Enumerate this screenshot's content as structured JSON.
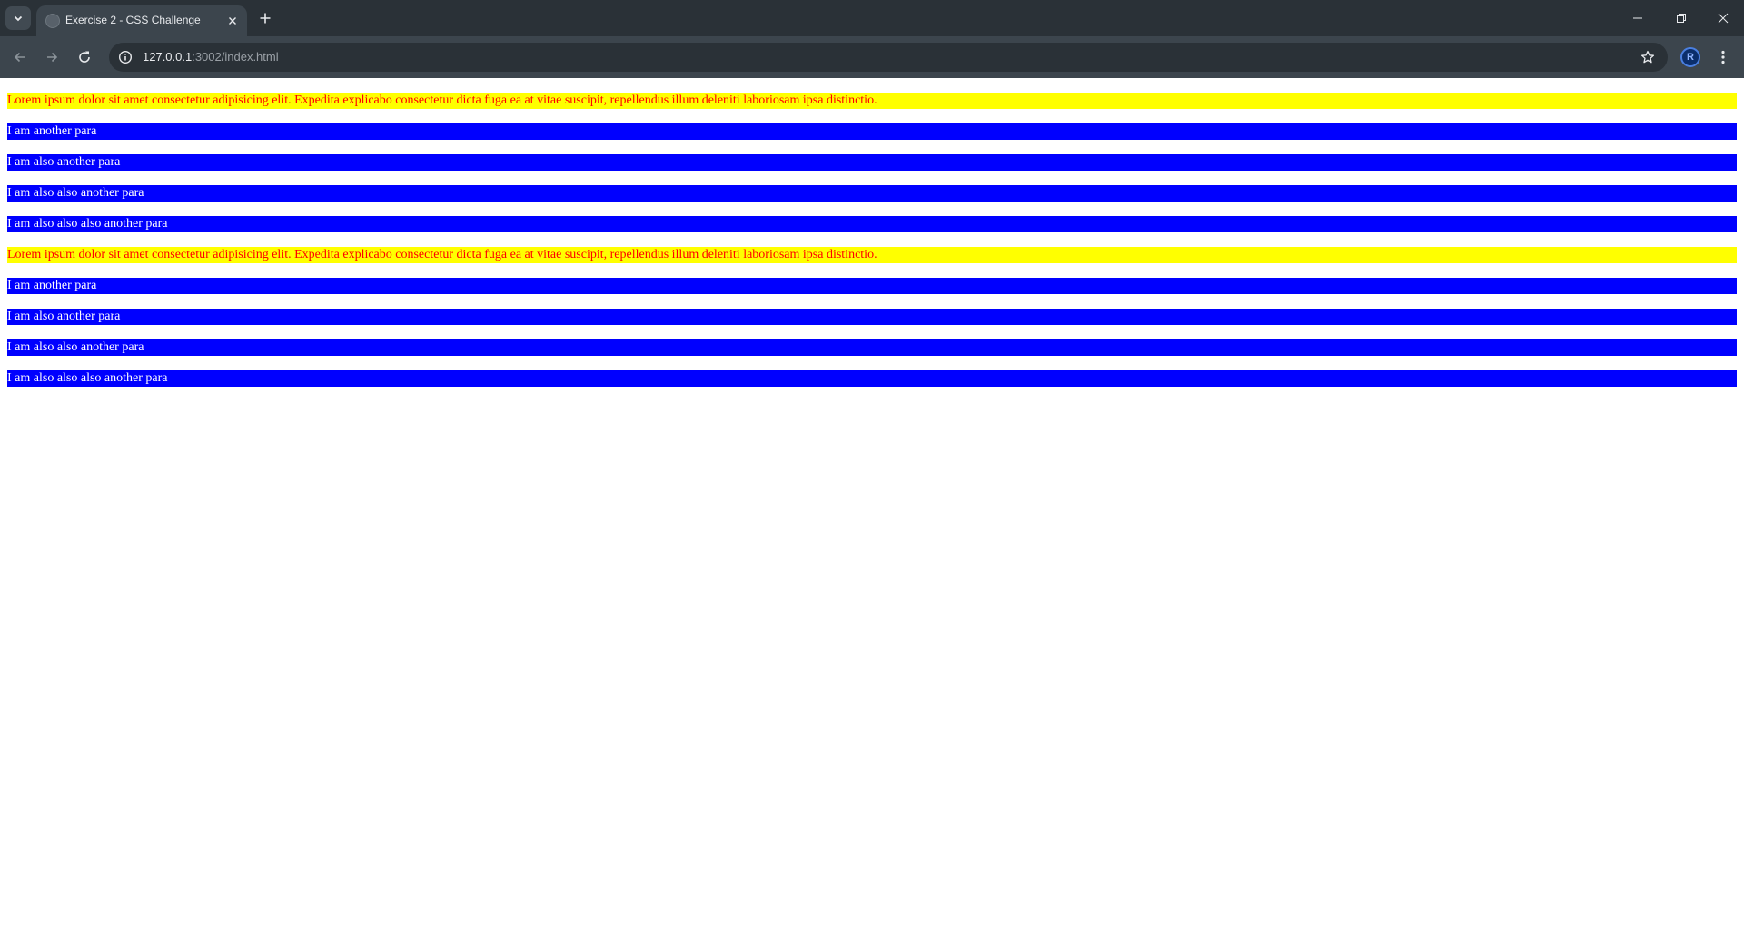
{
  "browser": {
    "tab_title": "Exercise 2 - CSS Challenge",
    "url_host": "127.0.0.1",
    "url_path": ":3002/index.html",
    "profile_initial": "R"
  },
  "content": {
    "groups": [
      {
        "lorem": "Lorem ipsum dolor sit amet consectetur adipisicing elit. Expedita explicabo consectetur dicta fuga ea at vitae suscipit, repellendus illum deleniti laboriosam ipsa distinctio.",
        "paras": [
          "I am another para",
          "I am also another para",
          "I am also also another para",
          "I am also also also another para"
        ]
      },
      {
        "lorem": "Lorem ipsum dolor sit amet consectetur adipisicing elit. Expedita explicabo consectetur dicta fuga ea at vitae suscipit, repellendus illum deleniti laboriosam ipsa distinctio.",
        "paras": [
          "I am another para",
          "I am also another para",
          "I am also also another para",
          "I am also also also another para"
        ]
      }
    ]
  },
  "colors": {
    "lorem_bg": "#ffff00",
    "lorem_text": "#ff0000",
    "para_bg": "#0000ff",
    "para_text": "#ffffff"
  },
  "icons": {
    "tab_search": "chevron-down-icon",
    "tab_close": "close-icon",
    "new_tab": "plus-icon",
    "back": "arrow-left-icon",
    "forward": "arrow-right-icon",
    "reload": "reload-icon",
    "site_info": "info-icon",
    "bookmark": "star-icon",
    "menu": "kebab-menu-icon"
  }
}
